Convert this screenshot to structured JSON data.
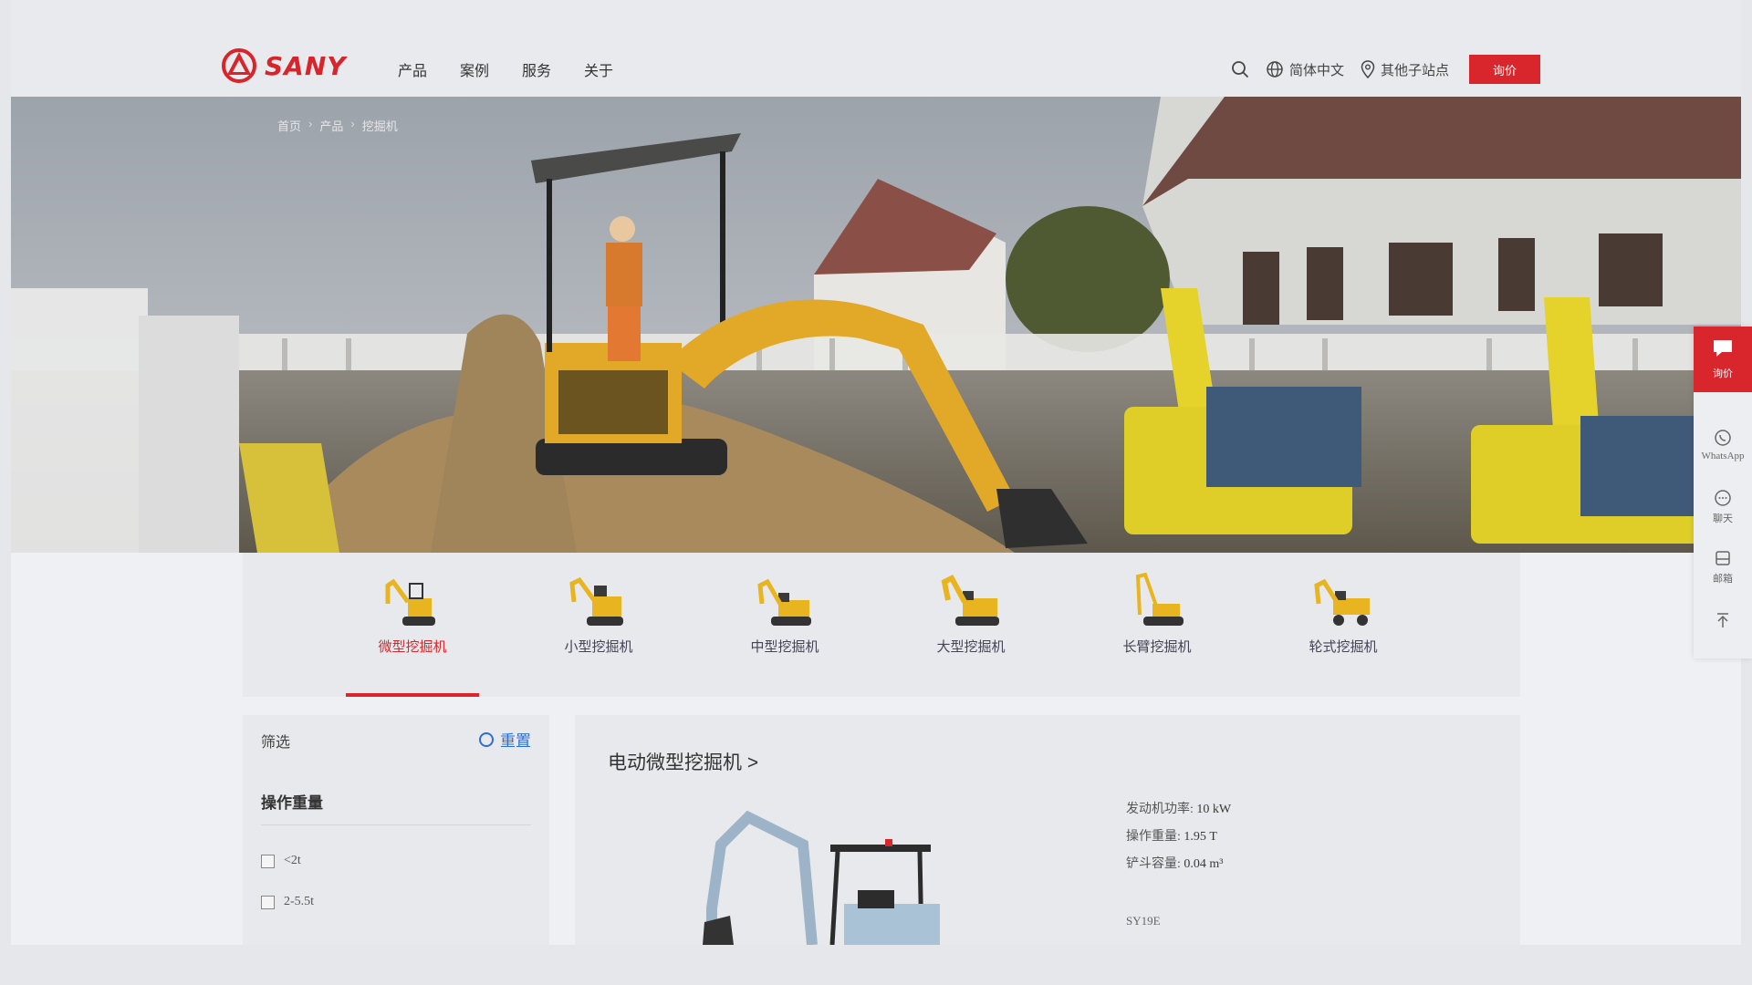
{
  "brand": {
    "name": "SANY"
  },
  "nav": {
    "items": [
      "产品",
      "案例",
      "服务",
      "关于"
    ]
  },
  "nav_right": {
    "language": "简体中文",
    "sites": "其他子站点",
    "inquiry": "询价"
  },
  "breadcrumb": [
    "首页",
    "产品",
    "挖掘机"
  ],
  "categories": {
    "items": [
      "微型挖掘机",
      "小型挖掘机",
      "中型挖掘机",
      "大型挖掘机",
      "长臂挖掘机",
      "轮式挖掘机"
    ],
    "active": "微型挖掘机"
  },
  "filter": {
    "heading": "筛选",
    "reset": "重置",
    "group_title": "操作重量",
    "options": [
      "<2t",
      "2-5.5t"
    ]
  },
  "product": {
    "title": "电动微型挖掘机 >",
    "specs": [
      {
        "label": "发动机功率:",
        "value": "10 kW"
      },
      {
        "label": "操作重量:",
        "value": "1.95 T"
      },
      {
        "label": "铲斗容量:",
        "value": "0.04 m³"
      }
    ],
    "model": "SY19E"
  },
  "side_tools": {
    "inquiry": "询价",
    "whatsapp": "WhatsApp",
    "chat": "聊天",
    "mail": "邮箱"
  },
  "colors": {
    "accent": "#d9262c",
    "link": "#2a6ed8",
    "machine_yellow": "#e8b520"
  }
}
